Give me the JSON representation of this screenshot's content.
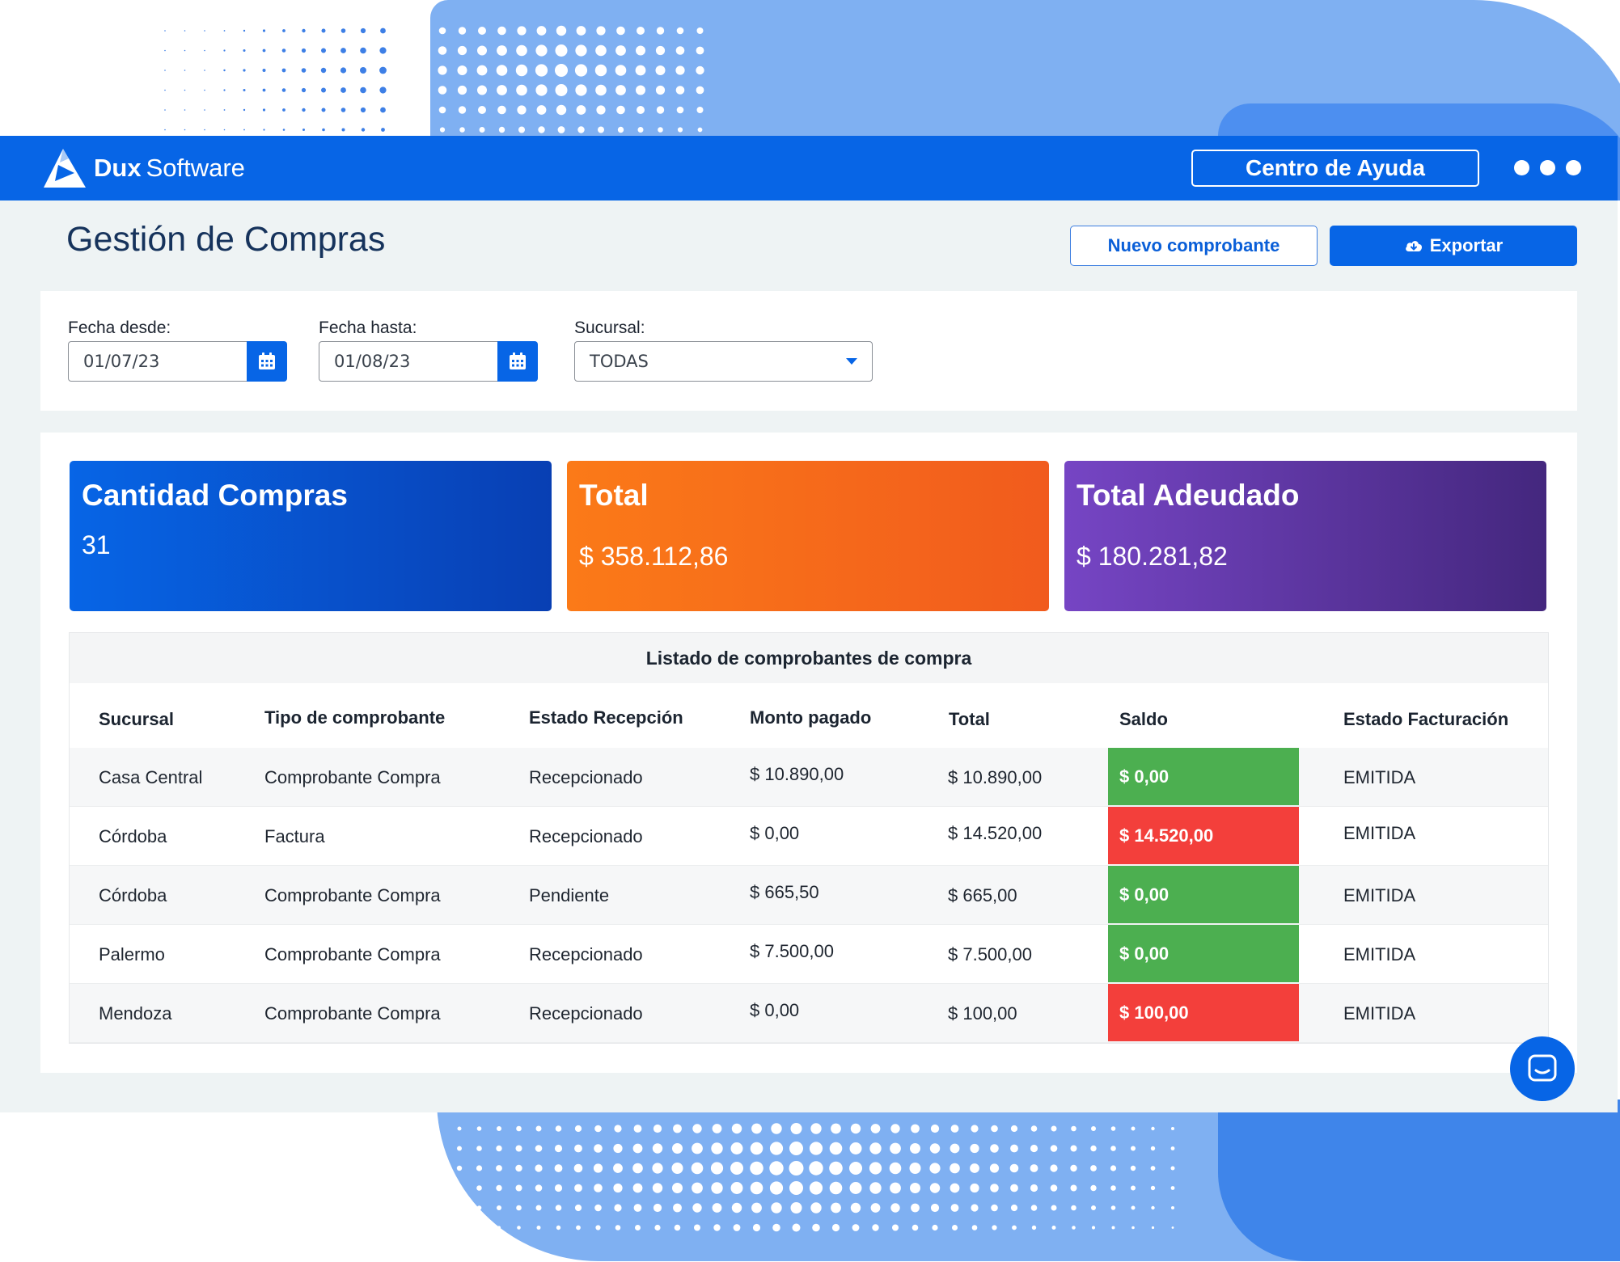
{
  "brand": {
    "name_bold": "Dux",
    "name_light": "Software"
  },
  "header": {
    "help_label": "Centro de Ayuda",
    "window_menu_icon": "more-dots-icon"
  },
  "page": {
    "title": "Gestión de Compras",
    "new_button": "Nuevo comprobante",
    "export_button": "Exportar",
    "export_icon": "cloud-download-icon"
  },
  "filters": {
    "from_label": "Fecha desde:",
    "from_value": "01/07/23",
    "to_label": "Fecha hasta:",
    "to_value": "01/08/23",
    "branch_label": "Sucursal:",
    "branch_value": "TODAS",
    "calendar_icon": "calendar-icon",
    "dropdown_icon": "caret-down-icon"
  },
  "cards": [
    {
      "title": "Cantidad Compras",
      "value": "31",
      "color": "#0765e6"
    },
    {
      "title": "Total",
      "value": "$ 358.112,86",
      "color": "#f96e1a"
    },
    {
      "title": "Total Adeudado",
      "value": "$ 180.281,82",
      "color": "#5d38a8"
    }
  ],
  "table": {
    "caption": "Listado de comprobantes de compra",
    "columns": [
      "Sucursal",
      "Tipo de comprobante",
      "Estado Recepción",
      "Monto pagado",
      "Total",
      "Saldo",
      "Estado Facturación"
    ],
    "rows": [
      {
        "sucursal": "Casa Central",
        "tipo": "Comprobante Compra",
        "recepcion": "Recepcionado",
        "pagado": "$ 10.890,00",
        "total": "$ 10.890,00",
        "saldo": "$ 0,00",
        "saldo_status": "green",
        "facturacion": "EMITIDA"
      },
      {
        "sucursal": "Córdoba",
        "tipo": "Factura",
        "recepcion": "Recepcionado",
        "pagado": "$ 0,00",
        "total": "$ 14.520,00",
        "saldo": "$ 14.520,00",
        "saldo_status": "red",
        "facturacion": "EMITIDA"
      },
      {
        "sucursal": "Córdoba",
        "tipo": "Comprobante Compra",
        "recepcion": "Pendiente",
        "pagado": "$ 665,50",
        "total": "$ 665,00",
        "saldo": "$ 0,00",
        "saldo_status": "green",
        "facturacion": "EMITIDA"
      },
      {
        "sucursal": "Palermo",
        "tipo": "Comprobante Compra",
        "recepcion": "Recepcionado",
        "pagado": "$ 7.500,00",
        "total": "$ 7.500,00",
        "saldo": "$ 0,00",
        "saldo_status": "green",
        "facturacion": "EMITIDA"
      },
      {
        "sucursal": "Mendoza",
        "tipo": "Comprobante Compra",
        "recepcion": "Recepcionado",
        "pagado": "$ 0,00",
        "total": "$ 100,00",
        "saldo": "$ 100,00",
        "saldo_status": "red",
        "facturacion": "EMITIDA"
      }
    ]
  },
  "chat": {
    "icon": "chat-bubble-icon"
  },
  "colors": {
    "primary": "#0765e6",
    "saldo_ok": "#4caf50",
    "saldo_due": "#f33f3b"
  }
}
